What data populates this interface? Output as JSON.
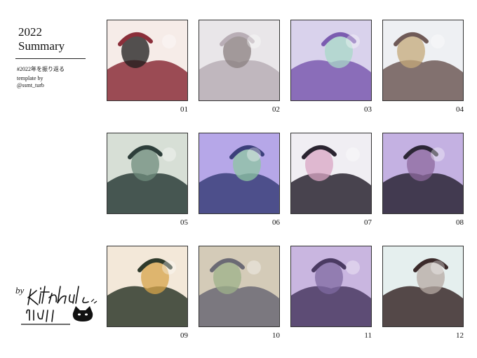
{
  "summary": {
    "year": "2022",
    "title": "Summary",
    "hashtag": "#2022年を振り返る",
    "template_line1": "template by",
    "template_line2": "@ssmt_turb",
    "by": "by"
  },
  "tiles": [
    {
      "number": "01",
      "bg": "#f6ece8",
      "accent": "#8b2f3a",
      "figure": "#1b1b1b"
    },
    {
      "number": "02",
      "bg": "#e9e6e9",
      "accent": "#b9aeb6",
      "figure": "#8a7f7f"
    },
    {
      "number": "03",
      "bg": "#d9d2ec",
      "accent": "#7b5cb0",
      "figure": "#a8d8c8"
    },
    {
      "number": "04",
      "bg": "#eef0f3",
      "accent": "#6f5a57",
      "figure": "#c4a97a"
    },
    {
      "number": "05",
      "bg": "#d7dfd6",
      "accent": "#2d3e3a",
      "figure": "#6f8c7c"
    },
    {
      "number": "06",
      "bg": "#b6a7e8",
      "accent": "#3b3f7a",
      "figure": "#8ec6a2"
    },
    {
      "number": "07",
      "bg": "#f0eef3",
      "accent": "#2a2430",
      "figure": "#d9a6c4"
    },
    {
      "number": "08",
      "bg": "#c4b1e2",
      "accent": "#2c2636",
      "figure": "#8d6a9e"
    },
    {
      "number": "09",
      "bg": "#f3e8d9",
      "accent": "#2f3a2b",
      "figure": "#d7a44a"
    },
    {
      "number": "10",
      "bg": "#d4cbb8",
      "accent": "#6b6a74",
      "figure": "#9db28a"
    },
    {
      "number": "11",
      "bg": "#c9b6e0",
      "accent": "#4a3a62",
      "figure": "#7f6aa2"
    },
    {
      "number": "12",
      "bg": "#e5efee",
      "accent": "#3b2a2a",
      "figure": "#b5aaa3"
    }
  ]
}
